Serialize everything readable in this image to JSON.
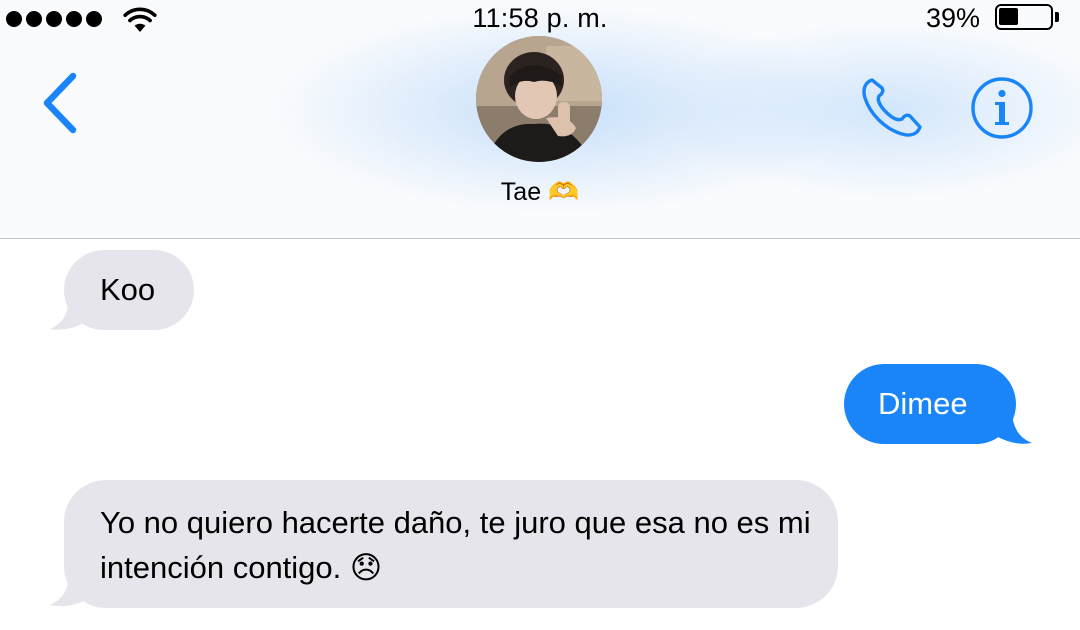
{
  "status_bar": {
    "time": "11:58 p. m.",
    "battery_percent": "39%",
    "battery_level": 0.39,
    "signal_dots": 5,
    "signal_icon": "signal-dots-icon",
    "wifi_icon": "wifi-icon",
    "battery_icon": "battery-icon"
  },
  "header": {
    "contact_name": "Tae 🫶",
    "back_icon": "chevron-left-icon",
    "phone_icon": "phone-icon",
    "info_icon": "info-icon",
    "avatar_icon": "contact-avatar-photo"
  },
  "messages": [
    {
      "direction": "incoming",
      "text": "Koo"
    },
    {
      "direction": "outgoing",
      "text": "Dimee"
    },
    {
      "direction": "incoming",
      "text": "Yo no quiero hacerte daño, te juro que esa no es mi intención contigo. 😞"
    }
  ],
  "colors": {
    "accent": "#1a85f8",
    "incoming_bubble": "#e6e5eb",
    "outgoing_bubble": "#1a85f8"
  }
}
